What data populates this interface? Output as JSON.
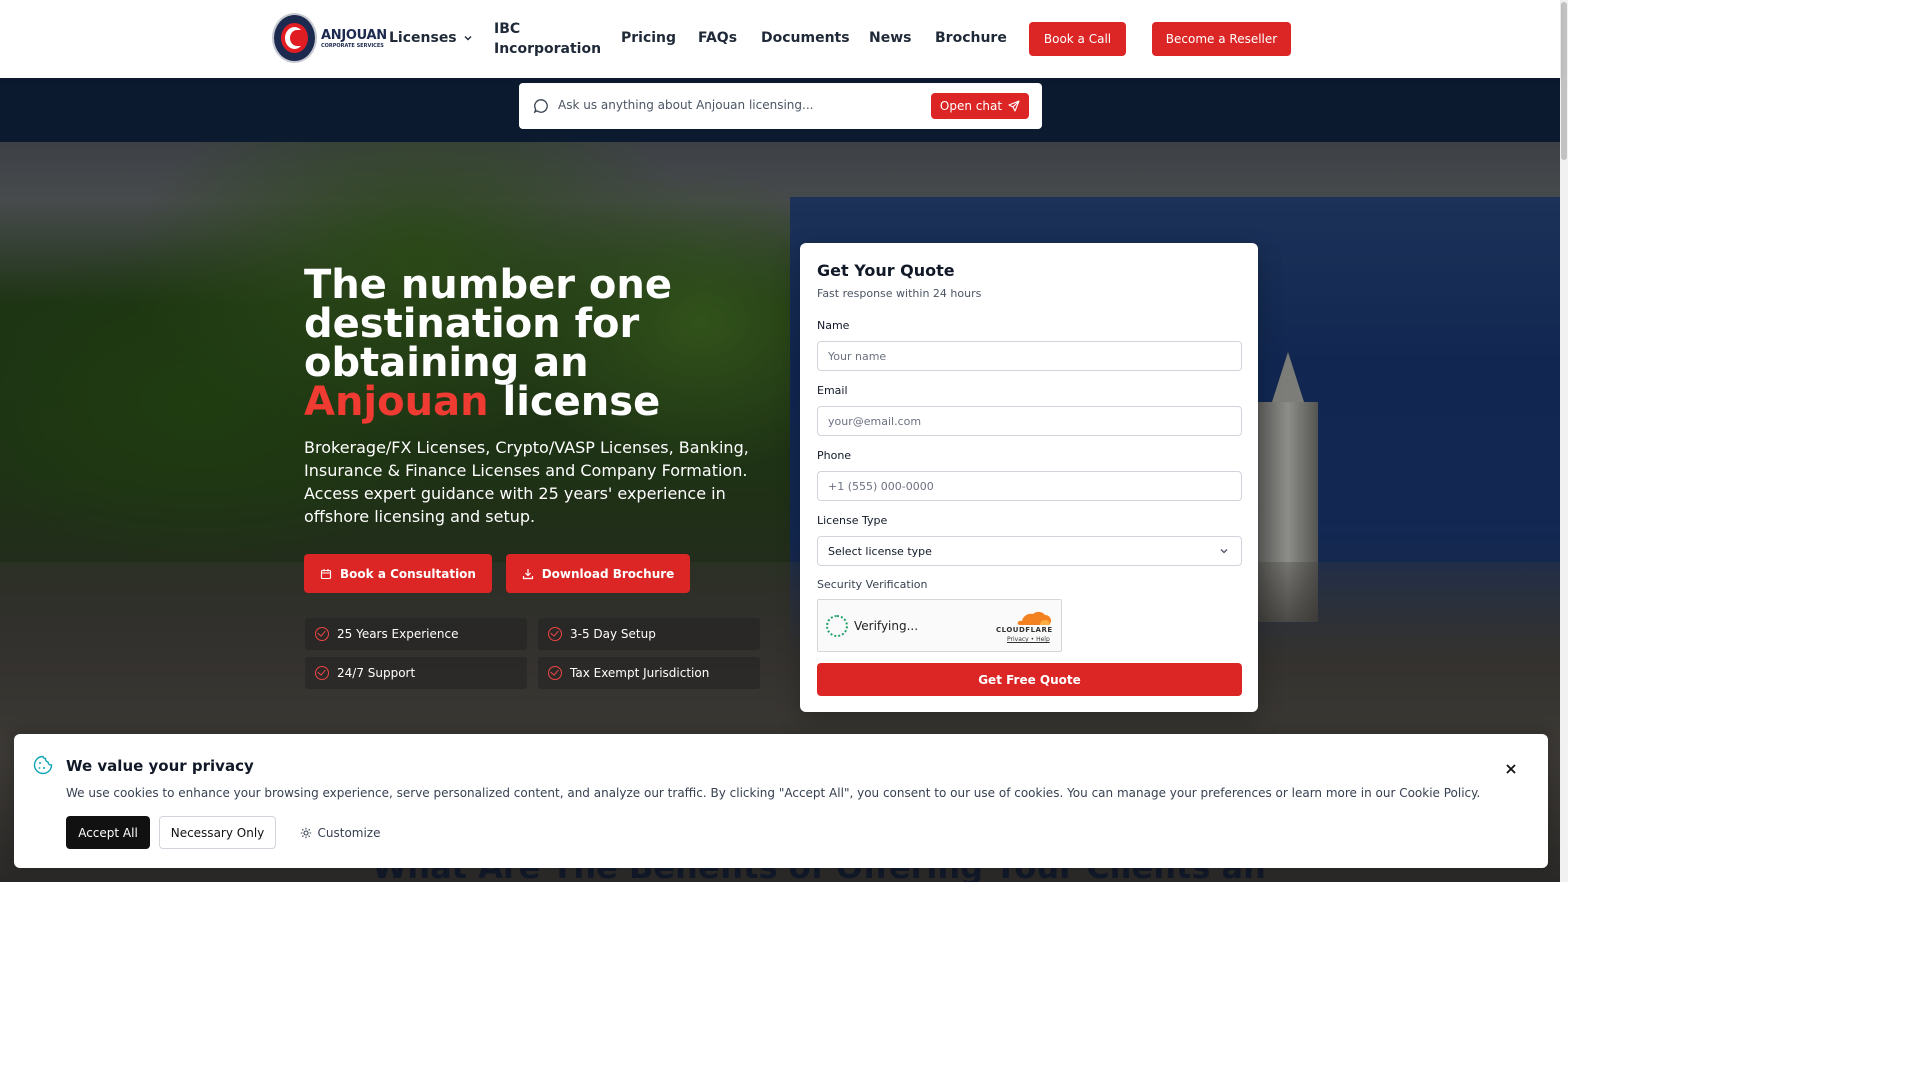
{
  "header": {
    "logo_text": "ANJOUAN",
    "logo_subtext": "CORPORATE SERVICES",
    "nav": {
      "licenses": "Licenses",
      "ibc": "IBC Incorporation",
      "pricing": "Pricing",
      "faqs": "FAQs",
      "documents": "Documents",
      "news": "News",
      "brochure": "Brochure"
    },
    "book_call": "Book a Call",
    "reseller": "Become a Reseller"
  },
  "chat": {
    "placeholder": "Ask us anything about Anjouan licensing...",
    "button": "Open chat"
  },
  "hero": {
    "title_part1": "The number one destination for obtaining an",
    "title_highlight": "Anjouan",
    "title_part2": "license",
    "subtitle": "Brokerage/FX Licenses, Crypto/VASP Licenses, Banking, Insurance & Finance Licenses and Company Formation. Access expert guidance with 25 years' experience in offshore licensing and setup.",
    "btn_consult": "Book a Consultation",
    "btn_brochure": "Download Brochure",
    "features": [
      "25 Years Experience",
      "3-5 Day Setup",
      "24/7 Support",
      "Tax Exempt Jurisdiction"
    ]
  },
  "quote": {
    "title": "Get Your Quote",
    "subtitle": "Fast response within 24 hours",
    "name_label": "Name",
    "name_placeholder": "Your name",
    "email_label": "Email",
    "email_placeholder": "your@email.com",
    "phone_label": "Phone",
    "phone_placeholder": "+1 (555) 000-0000",
    "license_label": "License Type",
    "license_value": "Select license type",
    "security_label": "Security Verification",
    "verifying": "Verifying...",
    "cloudflare": "CLOUDFLARE",
    "cf_links": "Privacy • Help",
    "submit": "Get Free Quote"
  },
  "section_heading": "What Are The Benefits of Offering Your Clients an",
  "cookie": {
    "title": "We value your privacy",
    "text": "We use cookies to enhance your browsing experience, serve personalized content, and analyze our traffic. By clicking \"Accept All\", you consent to our use of cookies. You can manage your preferences or learn more in our Cookie Policy.",
    "accept": "Accept All",
    "necessary": "Necessary Only",
    "customize": "Customize"
  },
  "colors": {
    "accent": "#dc2626",
    "navy": "#0c1a30"
  }
}
